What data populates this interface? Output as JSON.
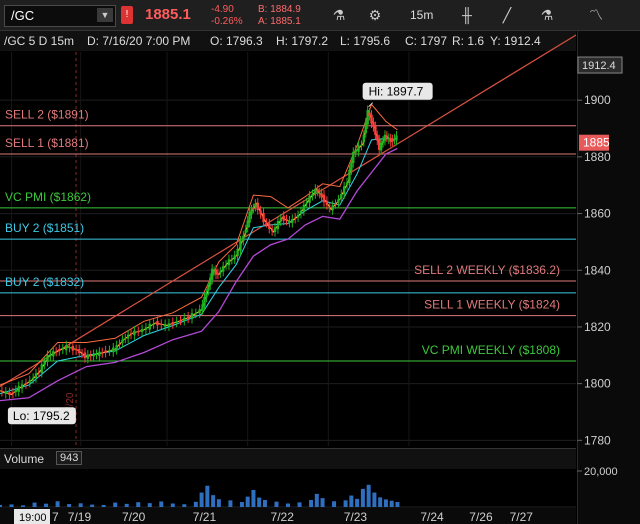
{
  "toolbar": {
    "symbol": "/GC",
    "last_price": "1885.1",
    "change": "-4.90",
    "change_pct": "-0.26%",
    "bid": "B: 1884.9",
    "ask": "A: 1885.1",
    "interval": "15m",
    "icons": [
      "chevron-down-icon",
      "alert-icon",
      "flask-icon",
      "gear-icon",
      "candle-icon",
      "line-draw-icon",
      "study-flask-icon",
      "pattern-icon"
    ]
  },
  "info": {
    "symbol_period": "/GC 5 D 15m",
    "date": "D: 7/16/20 7:00 PM",
    "open": "O: 1796.3",
    "high": "H: 1797.2",
    "low": "L: 1795.6",
    "close": "C: 1797",
    "range": "R: 1.6",
    "y_value": "Y: 1912.4"
  },
  "volume": {
    "label": "Volume",
    "value": "943",
    "axis_label": "20,000",
    "max": 20000
  },
  "colors": {
    "up": "#1fb41f",
    "down": "#ff3b3b",
    "bg": "#000000",
    "sell": "#e07a7a",
    "pmi": "#3cc83c",
    "buy": "#3cc9e6",
    "trend": "#d9523f"
  },
  "chart_data": {
    "type": "line",
    "ylim": [
      1778,
      1917
    ],
    "y_ticks": [
      1780,
      1800,
      1820,
      1840,
      1860,
      1880,
      1900
    ],
    "y_tick_labels": [
      "1780",
      "1800",
      "1820",
      "1840",
      "1860",
      "1880",
      "1900"
    ],
    "x_tick_labels": [
      "7/19",
      "7/20",
      "7/21",
      "7/22",
      "7/23",
      "7/24",
      "7/26",
      "7/27"
    ],
    "x_time_badge": "19:00",
    "x_partial_label": "7",
    "vertical_date_label": "7/20",
    "current_price_badge": "1885",
    "y_cursor_badge": "1912.4",
    "hi_label": "Hi: 1897.7",
    "lo_label": "Lo: 1795.2",
    "hi": 1897.7,
    "lo": 1795.2,
    "levels": [
      {
        "label": "SELL 2 ($1891)",
        "value": 1891,
        "kind": "sell",
        "align": "left"
      },
      {
        "label": "SELL 1 ($1881)",
        "value": 1881,
        "kind": "sell",
        "align": "left"
      },
      {
        "label": "VC PMI  ($1862)",
        "value": 1862,
        "kind": "pmi",
        "align": "left"
      },
      {
        "label": "BUY 2 ($1851)",
        "value": 1851,
        "kind": "buy",
        "align": "left"
      },
      {
        "label": "SELL 2 WEEKLY ($1836.2)",
        "value": 1836.2,
        "kind": "sell",
        "align": "right"
      },
      {
        "label": "BUY 2 ($1832)",
        "value": 1832,
        "kind": "buy",
        "align": "left"
      },
      {
        "label": "SELL 1 WEEKLY ($1824)",
        "value": 1824,
        "kind": "sell",
        "align": "right"
      },
      {
        "label": "VC PMI WEEKLY ($1808)",
        "value": 1808,
        "kind": "pmi",
        "align": "right"
      }
    ],
    "trendline": [
      [
        0,
        1799
      ],
      [
        1,
        1923
      ]
    ],
    "price_path": [
      [
        0.0,
        1797.5
      ],
      [
        0.02,
        1796.2
      ],
      [
        0.035,
        1798.6
      ],
      [
        0.055,
        1801.2
      ],
      [
        0.07,
        1804.5
      ],
      [
        0.085,
        1809.8
      ],
      [
        0.1,
        1811.5
      ],
      [
        0.118,
        1813.0
      ],
      [
        0.135,
        1811.8
      ],
      [
        0.15,
        1809.5
      ],
      [
        0.165,
        1810.2
      ],
      [
        0.18,
        1811.0
      ],
      [
        0.2,
        1812.2
      ],
      [
        0.215,
        1815.5
      ],
      [
        0.23,
        1817.8
      ],
      [
        0.25,
        1819.0
      ],
      [
        0.27,
        1821.4
      ],
      [
        0.29,
        1820.5
      ],
      [
        0.31,
        1822.0
      ],
      [
        0.33,
        1823.5
      ],
      [
        0.35,
        1826.0
      ],
      [
        0.36,
        1832.0
      ],
      [
        0.37,
        1840.0
      ],
      [
        0.38,
        1838.5
      ],
      [
        0.395,
        1842.5
      ],
      [
        0.41,
        1845.0
      ],
      [
        0.425,
        1852.5
      ],
      [
        0.435,
        1860.0
      ],
      [
        0.445,
        1863.5
      ],
      [
        0.46,
        1857.5
      ],
      [
        0.475,
        1853.5
      ],
      [
        0.49,
        1858.5
      ],
      [
        0.505,
        1857.0
      ],
      [
        0.52,
        1859.5
      ],
      [
        0.535,
        1864.5
      ],
      [
        0.55,
        1868.5
      ],
      [
        0.56,
        1866.0
      ],
      [
        0.575,
        1861.5
      ],
      [
        0.59,
        1865.0
      ],
      [
        0.605,
        1871.5
      ],
      [
        0.615,
        1881.5
      ],
      [
        0.63,
        1884.5
      ],
      [
        0.64,
        1896.0
      ],
      [
        0.65,
        1890.5
      ],
      [
        0.66,
        1883.0
      ],
      [
        0.67,
        1887.5
      ],
      [
        0.68,
        1885.5
      ],
      [
        0.69,
        1887.0
      ]
    ],
    "ma_fast": [
      [
        0.0,
        1796.5
      ],
      [
        0.05,
        1799.5
      ],
      [
        0.1,
        1808.0
      ],
      [
        0.15,
        1810.0
      ],
      [
        0.2,
        1811.5
      ],
      [
        0.25,
        1817.0
      ],
      [
        0.3,
        1820.5
      ],
      [
        0.35,
        1824.5
      ],
      [
        0.38,
        1834.0
      ],
      [
        0.41,
        1842.0
      ],
      [
        0.44,
        1855.0
      ],
      [
        0.47,
        1856.0
      ],
      [
        0.5,
        1856.5
      ],
      [
        0.53,
        1861.0
      ],
      [
        0.56,
        1864.5
      ],
      [
        0.59,
        1863.0
      ],
      [
        0.62,
        1874.0
      ],
      [
        0.645,
        1886.0
      ],
      [
        0.67,
        1886.5
      ],
      [
        0.69,
        1886.2
      ]
    ],
    "band_upper": [
      [
        0.0,
        1799.5
      ],
      [
        0.05,
        1803.5
      ],
      [
        0.1,
        1814.5
      ],
      [
        0.15,
        1814.5
      ],
      [
        0.2,
        1816.0
      ],
      [
        0.25,
        1822.0
      ],
      [
        0.3,
        1825.0
      ],
      [
        0.35,
        1830.5
      ],
      [
        0.38,
        1843.0
      ],
      [
        0.41,
        1849.0
      ],
      [
        0.44,
        1866.5
      ],
      [
        0.47,
        1866.0
      ],
      [
        0.5,
        1862.0
      ],
      [
        0.53,
        1866.0
      ],
      [
        0.56,
        1870.5
      ],
      [
        0.59,
        1869.5
      ],
      [
        0.62,
        1884.0
      ],
      [
        0.645,
        1898.5
      ],
      [
        0.67,
        1892.5
      ],
      [
        0.69,
        1889.5
      ]
    ],
    "band_lower": [
      [
        0.0,
        1794.0
      ],
      [
        0.05,
        1795.0
      ],
      [
        0.1,
        1801.0
      ],
      [
        0.15,
        1806.0
      ],
      [
        0.2,
        1807.5
      ],
      [
        0.25,
        1811.0
      ],
      [
        0.3,
        1815.5
      ],
      [
        0.35,
        1818.5
      ],
      [
        0.38,
        1825.5
      ],
      [
        0.41,
        1836.0
      ],
      [
        0.44,
        1845.0
      ],
      [
        0.47,
        1849.0
      ],
      [
        0.5,
        1851.0
      ],
      [
        0.53,
        1856.0
      ],
      [
        0.56,
        1859.0
      ],
      [
        0.59,
        1858.0
      ],
      [
        0.62,
        1868.0
      ],
      [
        0.645,
        1874.5
      ],
      [
        0.67,
        1881.0
      ],
      [
        0.69,
        1883.0
      ]
    ],
    "volume_bars": [
      [
        0.0,
        1100
      ],
      [
        0.02,
        1400
      ],
      [
        0.04,
        900
      ],
      [
        0.06,
        2400
      ],
      [
        0.08,
        1800
      ],
      [
        0.1,
        3100
      ],
      [
        0.12,
        1600
      ],
      [
        0.14,
        2000
      ],
      [
        0.16,
        1300
      ],
      [
        0.18,
        1100
      ],
      [
        0.2,
        2400
      ],
      [
        0.22,
        1700
      ],
      [
        0.24,
        2600
      ],
      [
        0.26,
        2100
      ],
      [
        0.28,
        3000
      ],
      [
        0.3,
        1900
      ],
      [
        0.32,
        1500
      ],
      [
        0.34,
        2800
      ],
      [
        0.35,
        7800
      ],
      [
        0.36,
        11500
      ],
      [
        0.37,
        6400
      ],
      [
        0.38,
        4200
      ],
      [
        0.4,
        3600
      ],
      [
        0.42,
        2700
      ],
      [
        0.43,
        5600
      ],
      [
        0.44,
        9200
      ],
      [
        0.45,
        5100
      ],
      [
        0.46,
        3800
      ],
      [
        0.48,
        2900
      ],
      [
        0.5,
        1900
      ],
      [
        0.52,
        2500
      ],
      [
        0.54,
        3800
      ],
      [
        0.55,
        7100
      ],
      [
        0.56,
        4800
      ],
      [
        0.58,
        3100
      ],
      [
        0.6,
        3600
      ],
      [
        0.61,
        6200
      ],
      [
        0.62,
        4400
      ],
      [
        0.63,
        9800
      ],
      [
        0.64,
        12000
      ],
      [
        0.65,
        7800
      ],
      [
        0.66,
        5200
      ],
      [
        0.67,
        4100
      ],
      [
        0.68,
        3400
      ],
      [
        0.69,
        2700
      ]
    ]
  }
}
